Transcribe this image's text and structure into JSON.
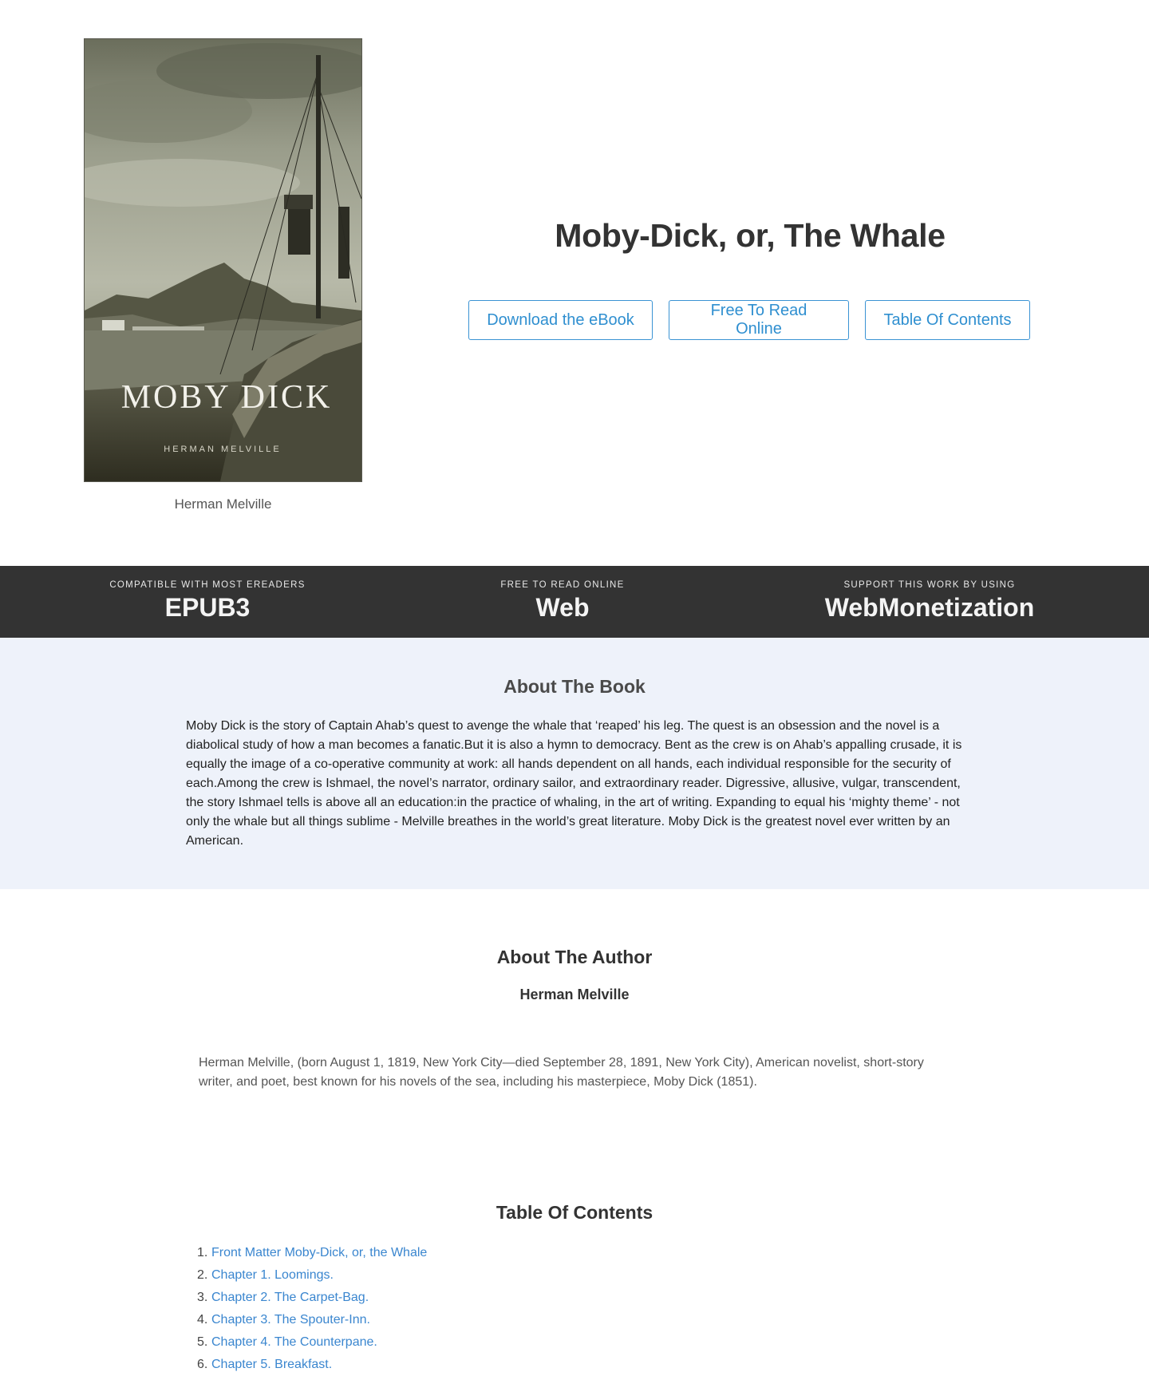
{
  "book": {
    "title": "Moby-Dick, or, The Whale",
    "cover_title": "MOBY DICK",
    "cover_author": "HERMAN MELVILLE",
    "author": "Herman Melville"
  },
  "hero_buttons": {
    "download": "Download the eBook",
    "read_online": "Free To Read Online",
    "toc": "Table Of Contents"
  },
  "features": [
    {
      "small": "COMPATIBLE WITH MOST EREADERS",
      "big": "EPUB3"
    },
    {
      "small": "FREE TO READ ONLINE",
      "big": "Web"
    },
    {
      "small": "SUPPORT THIS WORK BY USING",
      "big": "WebMonetization"
    }
  ],
  "about_book": {
    "heading": "About The Book",
    "text": "Moby Dick is the story of Captain Ahab’s quest to avenge the whale that ‘reaped’ his leg. The quest is an obsession and the novel is a diabolical study of how a man becomes a fanatic.But it is also a hymn to democracy. Bent as the crew is on Ahab’s appalling crusade, it is equally the image of a co-operative community at work: all hands dependent on all hands, each individual responsible for the security of each.Among the crew is Ishmael, the novel’s narrator, ordinary sailor, and extraordinary reader. Digressive, allusive, vulgar, transcendent, the story Ishmael tells is above all an education:in the practice of whaling, in the art of writing. Expanding to equal his ‘mighty theme’ - not only the whale but all things sublime - Melville breathes in the world’s great literature. Moby Dick is the greatest novel ever written by an American."
  },
  "about_author": {
    "heading": "About The Author",
    "name": "Herman Melville",
    "bio": "Herman Melville, (born August 1, 1819, New York City—died September 28, 1891, New York City), American novelist, short-story writer, and poet, best known for his novels of the sea, including his masterpiece, Moby Dick (1851)."
  },
  "toc": {
    "heading": "Table Of Contents",
    "items": [
      {
        "num": "1.",
        "label": "Front Matter Moby-Dick, or, the Whale"
      },
      {
        "num": "2.",
        "label": "Chapter 1. Loomings."
      },
      {
        "num": "3.",
        "label": "Chapter 2. The Carpet-Bag."
      },
      {
        "num": "4.",
        "label": "Chapter 3. The Spouter-Inn."
      },
      {
        "num": "5.",
        "label": "Chapter 4. The Counterpane."
      },
      {
        "num": "6.",
        "label": "Chapter 5. Breakfast."
      }
    ]
  }
}
